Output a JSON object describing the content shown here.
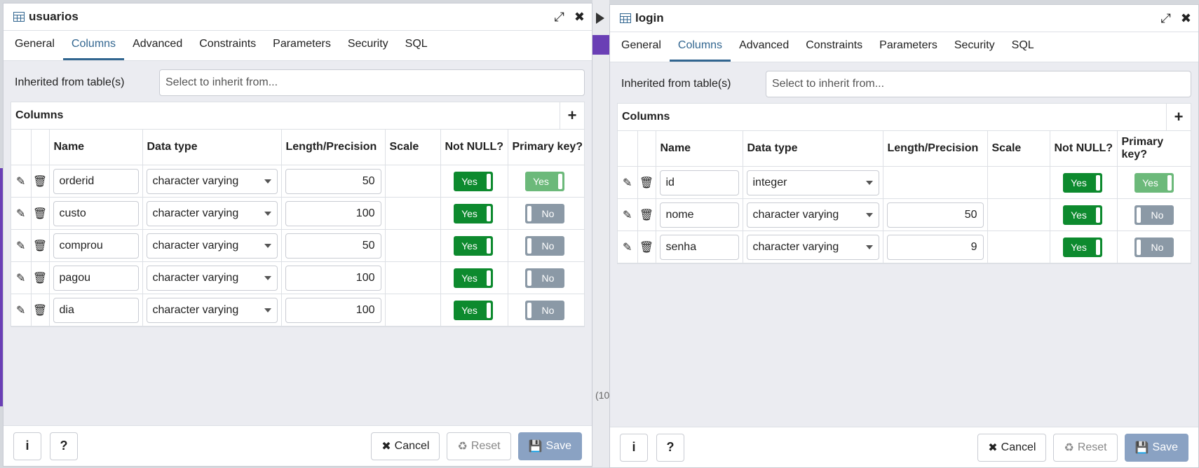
{
  "left": {
    "title": "usuarios",
    "tabs": [
      "General",
      "Columns",
      "Advanced",
      "Constraints",
      "Parameters",
      "Security",
      "SQL"
    ],
    "active_tab": "Columns",
    "inherit_label": "Inherited from table(s)",
    "inherit_placeholder": "Select to inherit from...",
    "grid_title": "Columns",
    "headers": [
      "Name",
      "Data type",
      "Length/Precision",
      "Scale",
      "Not NULL?",
      "Primary key?"
    ],
    "rows": [
      {
        "name": "orderid",
        "type": "character varying",
        "length": "50",
        "scale": "",
        "notnull": "Yes",
        "pk": "Yes"
      },
      {
        "name": "custo",
        "type": "character varying",
        "length": "100",
        "scale": "",
        "notnull": "Yes",
        "pk": "No"
      },
      {
        "name": "comprou",
        "type": "character varying",
        "length": "50",
        "scale": "",
        "notnull": "Yes",
        "pk": "No"
      },
      {
        "name": "pagou",
        "type": "character varying",
        "length": "100",
        "scale": "",
        "notnull": "Yes",
        "pk": "No"
      },
      {
        "name": "dia",
        "type": "character varying",
        "length": "100",
        "scale": "",
        "notnull": "Yes",
        "pk": "No"
      }
    ],
    "footer": {
      "info": "i",
      "help": "?",
      "cancel": "Cancel",
      "reset": "Reset",
      "save": "Save"
    }
  },
  "right": {
    "title": "login",
    "tabs": [
      "General",
      "Columns",
      "Advanced",
      "Constraints",
      "Parameters",
      "Security",
      "SQL"
    ],
    "active_tab": "Columns",
    "inherit_label": "Inherited from table(s)",
    "inherit_placeholder": "Select to inherit from...",
    "grid_title": "Columns",
    "headers": [
      "Name",
      "Data type",
      "Length/Precision",
      "Scale",
      "Not NULL?",
      "Primary key?"
    ],
    "rows": [
      {
        "name": "id",
        "type": "integer",
        "length": "",
        "scale": "",
        "notnull": "Yes",
        "pk": "Yes"
      },
      {
        "name": "nome",
        "type": "character varying",
        "length": "50",
        "scale": "",
        "notnull": "Yes",
        "pk": "No"
      },
      {
        "name": "senha",
        "type": "character varying",
        "length": "9",
        "scale": "",
        "notnull": "Yes",
        "pk": "No"
      }
    ],
    "footer": {
      "info": "i",
      "help": "?",
      "cancel": "Cancel",
      "reset": "Reset",
      "save": "Save"
    }
  },
  "background_text": "(10",
  "colors": {
    "accent": "#326690",
    "yes": "#0d8a2e",
    "no": "#8b99a6",
    "save": "#8aa2c3",
    "purple": "#6a3fb5"
  }
}
